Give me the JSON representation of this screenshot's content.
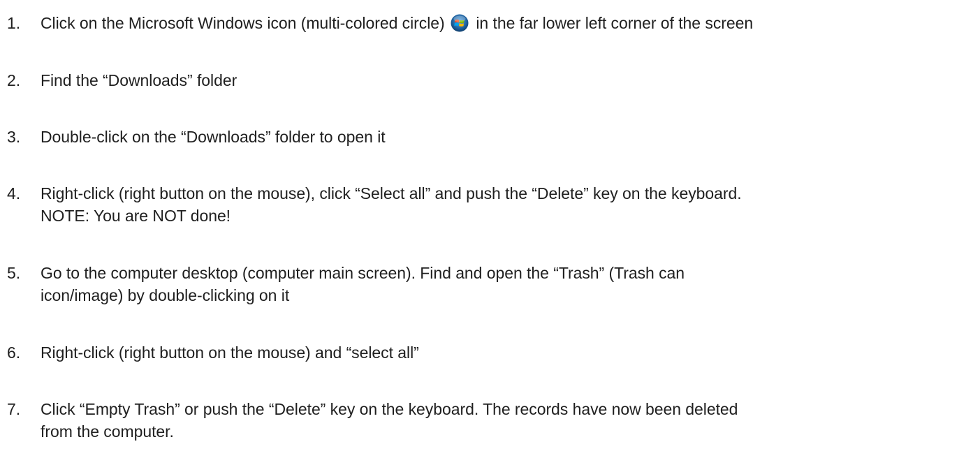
{
  "document": {
    "steps": [
      {
        "number": "1.",
        "text_before_icon": "Click on the Microsoft Windows icon (multi-colored circle)",
        "icon": "windows-start-orb-icon",
        "text_after_icon": "in the far lower left corner of the screen"
      },
      {
        "number": "2.",
        "lines": [
          "Find the “Downloads” folder"
        ]
      },
      {
        "number": "3.",
        "lines": [
          "Double-click on the “Downloads” folder to open it"
        ]
      },
      {
        "number": "4.",
        "lines": [
          "Right-click (right button on the mouse), click “Select all” and push the “Delete” key on the keyboard.",
          "NOTE: You are NOT done!"
        ]
      },
      {
        "number": "5.",
        "lines": [
          "Go to the computer desktop (computer main screen). Find and open the “Trash” (Trash can",
          "icon/image) by double-clicking on it"
        ]
      },
      {
        "number": "6.",
        "lines": [
          "Right-click (right button on the mouse) and “select all”"
        ]
      },
      {
        "number": "7.",
        "lines": [
          "Click “Empty Trash” or push the “Delete” key on the keyboard. The records have now been deleted",
          "from the computer."
        ]
      }
    ]
  }
}
